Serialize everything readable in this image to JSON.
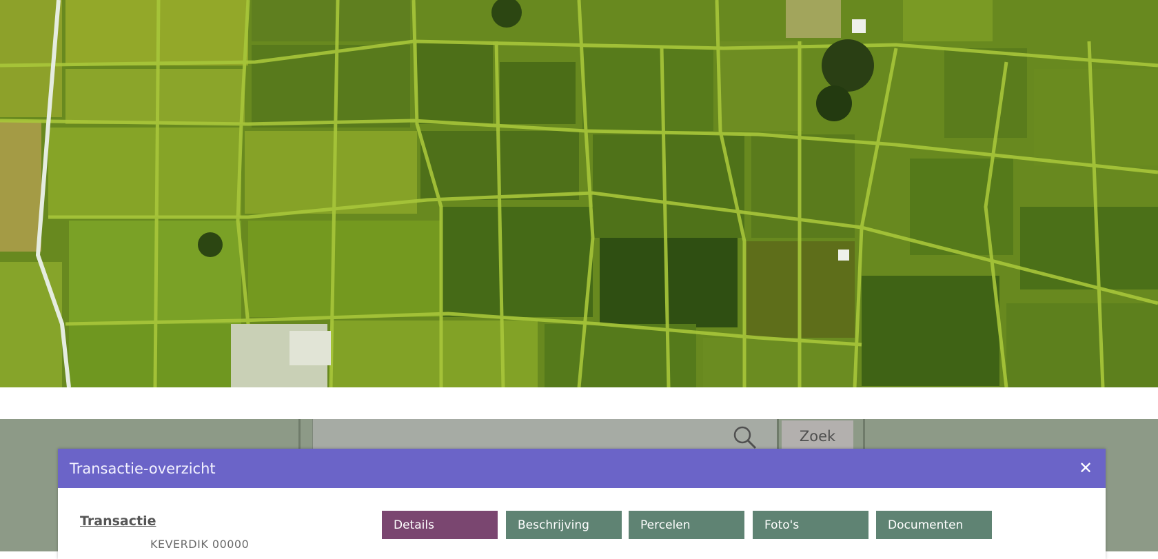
{
  "hero": {
    "image": "aerial-rice-fields-photo"
  },
  "search": {
    "placeholder": "",
    "button_label": "Zoek"
  },
  "dialog": {
    "title": "Transactie-overzicht",
    "close_icon": "close-icon",
    "section_heading": "Transactie",
    "transaction_ref": "KEVERDIK 00000",
    "tabs": [
      {
        "label": "Details",
        "active": true
      },
      {
        "label": "Beschrijving",
        "active": false
      },
      {
        "label": "Percelen",
        "active": false
      },
      {
        "label": "Foto's",
        "active": false
      },
      {
        "label": "Documenten",
        "active": false
      }
    ]
  },
  "colors": {
    "dialog_header": "#6b64c8",
    "tab_active": "#7a4670",
    "tab_inactive": "#5f8373",
    "toolbar": "#8d9a87"
  }
}
